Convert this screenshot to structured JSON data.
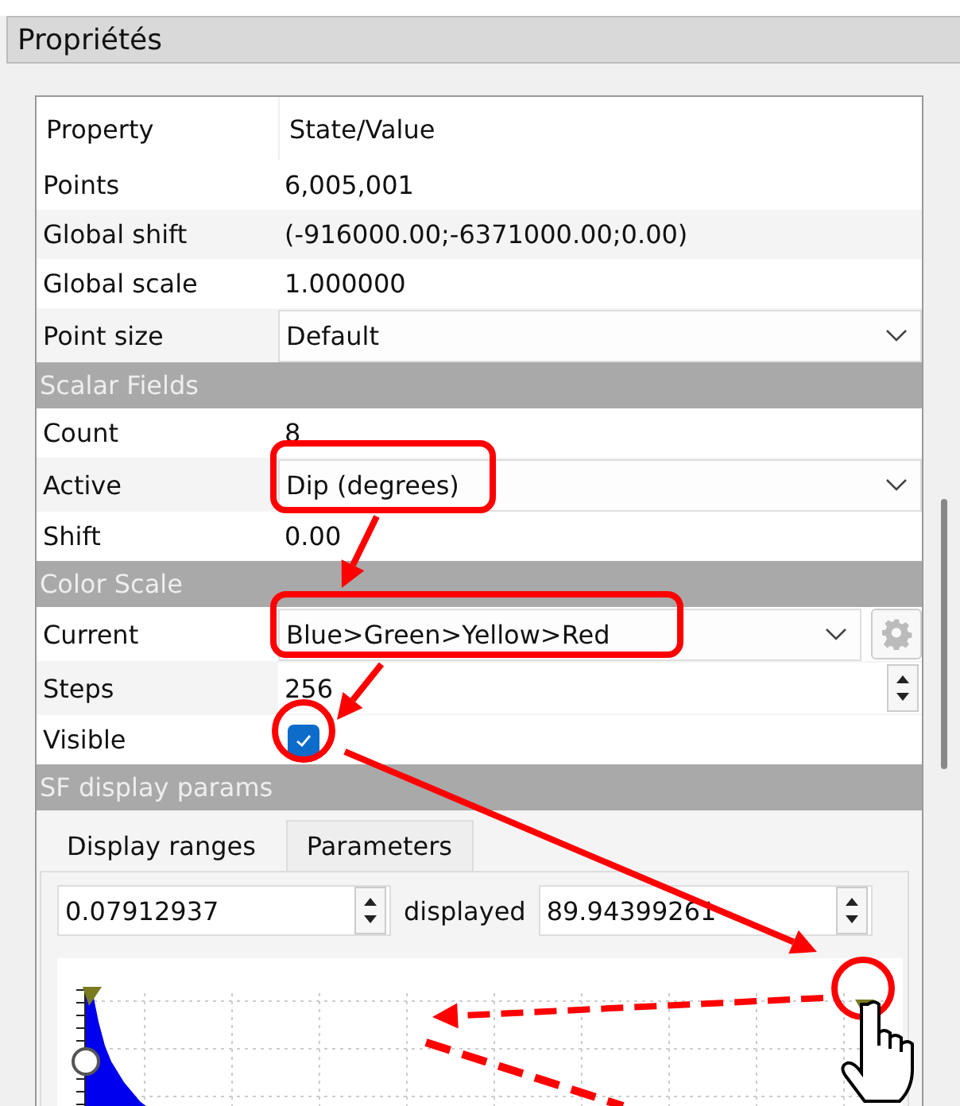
{
  "panel": {
    "title": "Propriétés"
  },
  "table": {
    "columns": [
      "Property",
      "State/Value"
    ],
    "rows": [
      {
        "kind": "text",
        "label": "Points",
        "value": "6,005,001"
      },
      {
        "kind": "text",
        "label": "Global shift",
        "value": "(-916000.00;-6371000.00;0.00)"
      },
      {
        "kind": "text",
        "label": "Global scale",
        "value": "1.000000"
      },
      {
        "kind": "combo",
        "label": "Point size",
        "value": "Default"
      },
      {
        "kind": "section",
        "label": "Scalar Fields"
      },
      {
        "kind": "text",
        "label": "Count",
        "value": "8"
      },
      {
        "kind": "combo",
        "label": "Active",
        "value": "Dip (degrees)"
      },
      {
        "kind": "text",
        "label": "Shift",
        "value": "0.00"
      },
      {
        "kind": "section",
        "label": "Color Scale"
      },
      {
        "kind": "combo_gear",
        "label": "Current",
        "value": "Blue>Green>Yellow>Red"
      },
      {
        "kind": "spin",
        "label": "Steps",
        "value": "256"
      },
      {
        "kind": "checkbox",
        "label": "Visible",
        "checked": true
      },
      {
        "kind": "section",
        "label": "SF display params"
      }
    ]
  },
  "sf_display": {
    "tabs": [
      {
        "label": "Display ranges",
        "selected": true
      },
      {
        "label": "Parameters",
        "selected": false
      }
    ],
    "min": "0.07912937",
    "separator": "displayed",
    "max": "89.94399261"
  }
}
